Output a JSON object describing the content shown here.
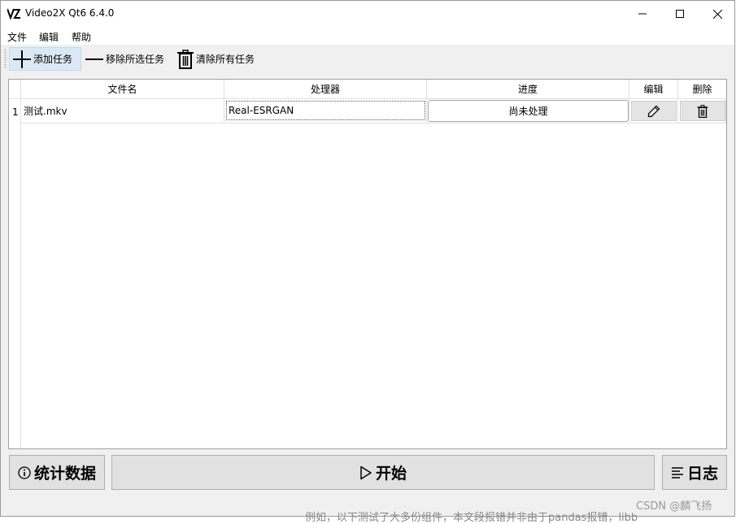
{
  "window": {
    "title": "Video2X Qt6 6.4.0",
    "app_icon": "video2x-logo-icon",
    "controls": [
      "minimize-icon",
      "maximize-icon",
      "close-icon"
    ]
  },
  "menubar": {
    "items": [
      {
        "label": "文件"
      },
      {
        "label": "编辑"
      },
      {
        "label": "帮助"
      }
    ]
  },
  "toolbar": {
    "add_label": "添加任务",
    "remove_label": "移除所选任务",
    "clear_label": "清除所有任务"
  },
  "table": {
    "headers": {
      "filename": "文件名",
      "processor": "处理器",
      "progress": "进度",
      "edit": "编辑",
      "delete": "删除"
    },
    "rows": [
      {
        "index": "1",
        "filename": "测试.mkv",
        "processor": "Real-ESRGAN",
        "progress": "尚未处理",
        "edit_icon": "pencil-icon",
        "delete_icon": "trash-icon"
      }
    ]
  },
  "bottom": {
    "stats_label": "统计数据",
    "start_label": "开始",
    "log_label": "日志"
  },
  "background": {
    "watermark": "CSDN @麟飞扬",
    "text_fragment": "例如，以下测试了大多份组件，本文段报错并非由于pandas报错，libb"
  }
}
